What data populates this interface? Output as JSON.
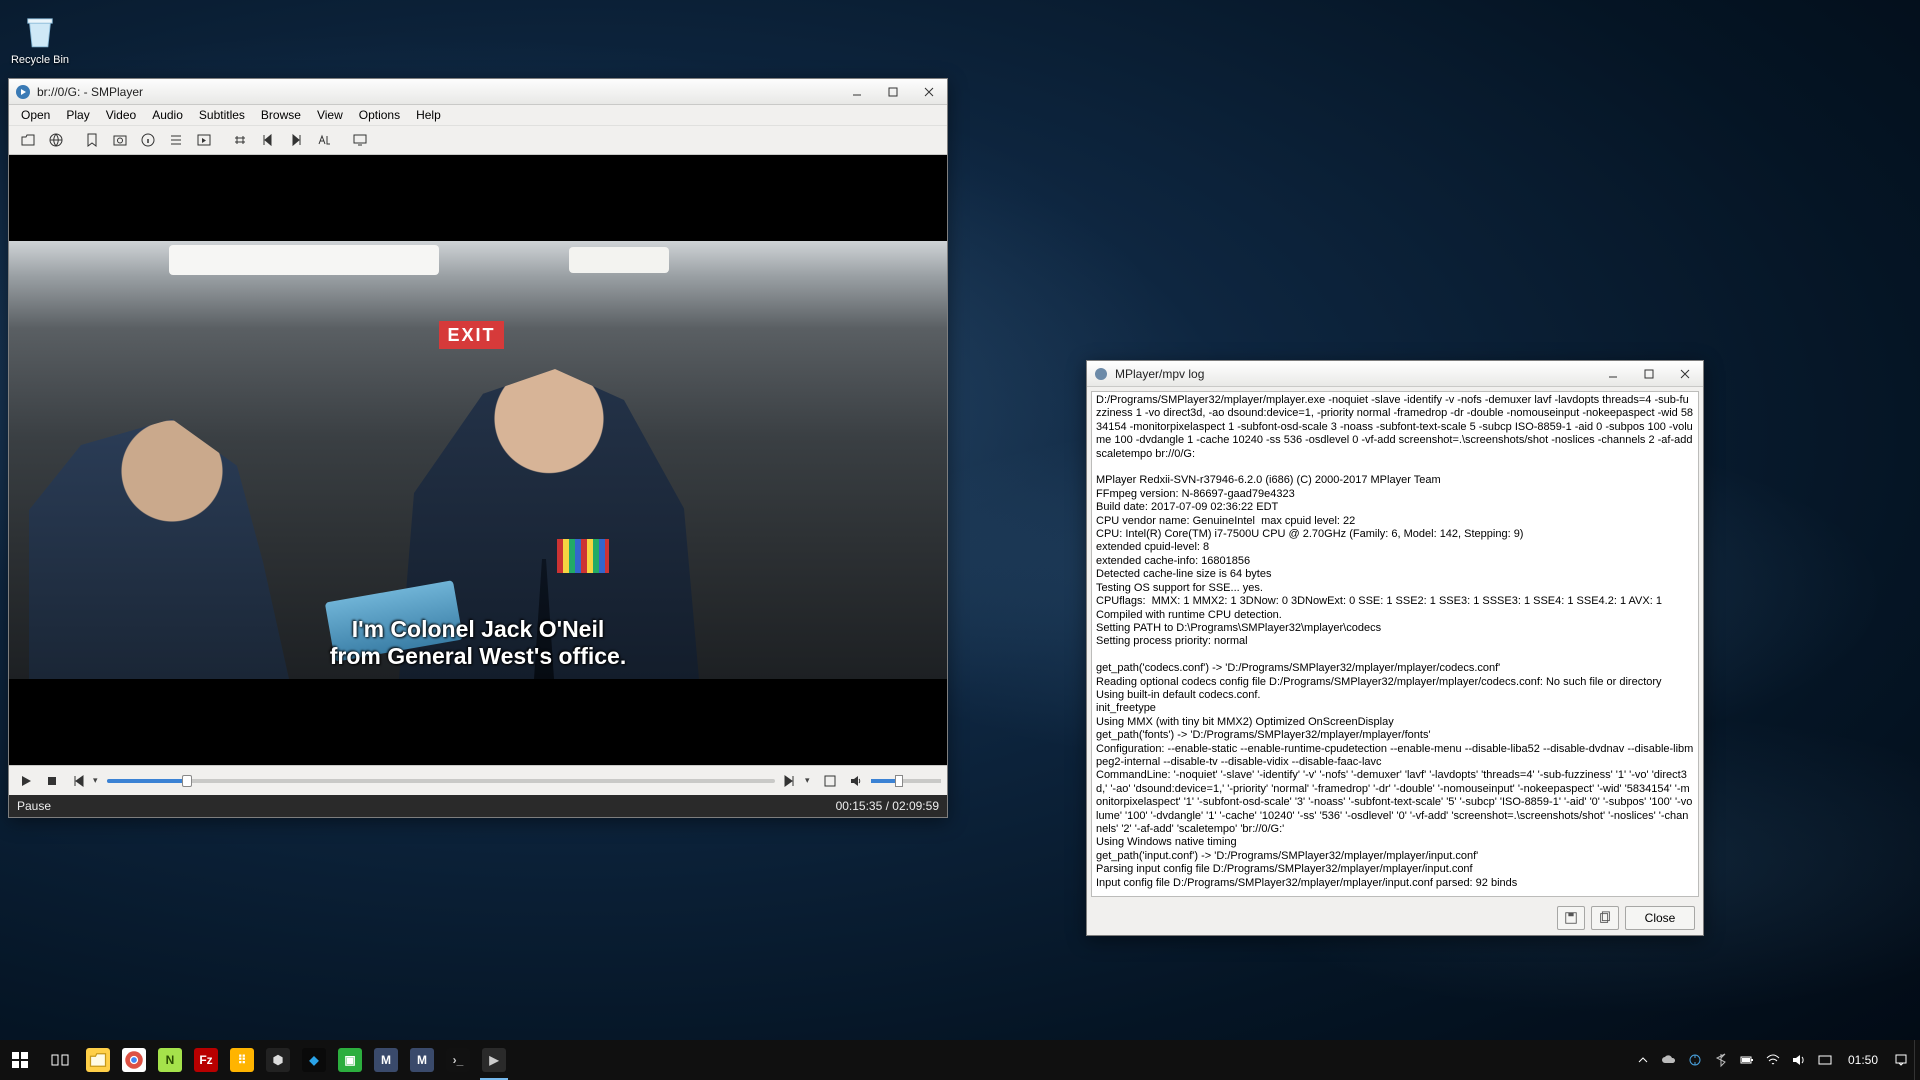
{
  "desktop": {
    "recycle_bin": "Recycle Bin"
  },
  "smplayer": {
    "title": "br://0/G: - SMPlayer",
    "menu": [
      "Open",
      "Play",
      "Video",
      "Audio",
      "Subtitles",
      "Browse",
      "View",
      "Options",
      "Help"
    ],
    "subtitle": "I'm Colonel Jack O'Neil\nfrom General West's office.",
    "exit_sign": "EXIT",
    "status_left": "Pause",
    "current_time": "00:15:35",
    "total_time": "02:09:59",
    "time_display": "00:15:35 / 02:09:59",
    "seek_pct": 12,
    "volume_pct": 40
  },
  "log": {
    "title": "MPlayer/mpv log",
    "close_btn": "Close",
    "text": "D:/Programs/SMPlayer32/mplayer/mplayer.exe -noquiet -slave -identify -v -nofs -demuxer lavf -lavdopts threads=4 -sub-fuzziness 1 -vo direct3d, -ao dsound:device=1, -priority normal -framedrop -dr -double -nomouseinput -nokeepaspect -wid 5834154 -monitorpixelaspect 1 -subfont-osd-scale 3 -noass -subfont-text-scale 5 -subcp ISO-8859-1 -aid 0 -subpos 100 -volume 100 -dvdangle 1 -cache 10240 -ss 536 -osdlevel 0 -vf-add screenshot=.\\screenshots/shot -noslices -channels 2 -af-add scaletempo br://0/G:\n\nMPlayer Redxii-SVN-r37946-6.2.0 (i686) (C) 2000-2017 MPlayer Team\nFFmpeg version: N-86697-gaad79e4323\nBuild date: 2017-07-09 02:36:22 EDT\nCPU vendor name: GenuineIntel  max cpuid level: 22\nCPU: Intel(R) Core(TM) i7-7500U CPU @ 2.70GHz (Family: 6, Model: 142, Stepping: 9)\nextended cpuid-level: 8\nextended cache-info: 16801856\nDetected cache-line size is 64 bytes\nTesting OS support for SSE... yes.\nCPUflags:  MMX: 1 MMX2: 1 3DNow: 0 3DNowExt: 0 SSE: 1 SSE2: 1 SSE3: 1 SSSE3: 1 SSE4: 1 SSE4.2: 1 AVX: 1\nCompiled with runtime CPU detection.\nSetting PATH to D:\\Programs\\SMPlayer32\\mplayer\\codecs\nSetting process priority: normal\n\nget_path('codecs.conf') -> 'D:/Programs/SMPlayer32/mplayer/mplayer/codecs.conf'\nReading optional codecs config file D:/Programs/SMPlayer32/mplayer/mplayer/codecs.conf: No such file or directory\nUsing built-in default codecs.conf.\ninit_freetype\nUsing MMX (with tiny bit MMX2) Optimized OnScreenDisplay\nget_path('fonts') -> 'D:/Programs/SMPlayer32/mplayer/mplayer/fonts'\nConfiguration: --enable-static --enable-runtime-cpudetection --enable-menu --disable-liba52 --disable-dvdnav --disable-libmpeg2-internal --disable-tv --disable-vidix --disable-faac-lavc\nCommandLine: '-noquiet' '-slave' '-identify' '-v' '-nofs' '-demuxer' 'lavf' '-lavdopts' 'threads=4' '-sub-fuzziness' '1' '-vo' 'direct3d,' '-ao' 'dsound:device=1,' '-priority' 'normal' '-framedrop' '-dr' '-double' '-nomouseinput' '-nokeepaspect' '-wid' '5834154' '-monitorpixelaspect' '1' '-subfont-osd-scale' '3' '-noass' '-subfont-text-scale' '5' '-subcp' 'ISO-8859-1' '-aid' '0' '-subpos' '100' '-volume' '100' '-dvdangle' '1' '-cache' '10240' '-ss' '536' '-osdlevel' '0' '-vf-add' 'screenshot=.\\screenshots/shot' '-noslices' '-channels' '2' '-af-add' 'scaletempo' 'br://0/G:'\nUsing Windows native timing\nget_path('input.conf') -> 'D:/Programs/SMPlayer32/mplayer/mplayer/input.conf'\nParsing input config file D:/Programs/SMPlayer32/mplayer/mplayer/input.conf\nInput config file D:/Programs/SMPlayer32/mplayer/mplayer/input.conf parsed: 92 binds"
  },
  "taskbar": {
    "clock": "01:50",
    "apps": [
      {
        "name": "start",
        "color": "#fff"
      },
      {
        "name": "taskview",
        "color": "#fff"
      },
      {
        "name": "file-explorer",
        "color": "#ffcf48"
      },
      {
        "name": "chrome",
        "color": "#dd5144"
      },
      {
        "name": "notepadpp",
        "color": "#a5e24b"
      },
      {
        "name": "filezilla",
        "color": "#b80000"
      },
      {
        "name": "proc",
        "color": "#ffb400"
      },
      {
        "name": "unity",
        "color": "#222"
      },
      {
        "name": "diamond",
        "color": "#2aa3e8"
      },
      {
        "name": "green",
        "color": "#2cae3e"
      },
      {
        "name": "m-app-1",
        "color": "#3a4a6b"
      },
      {
        "name": "m-app-2",
        "color": "#3a4a6b"
      },
      {
        "name": "cmd",
        "color": "#111"
      },
      {
        "name": "smplayer",
        "color": "#2a2a2a"
      }
    ]
  }
}
